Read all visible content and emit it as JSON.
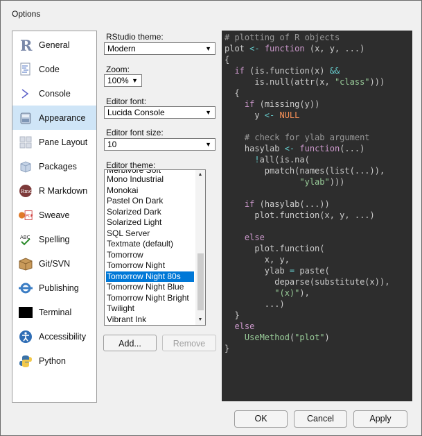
{
  "window": {
    "title": "Options"
  },
  "sidebar": {
    "items": [
      {
        "label": "General",
        "icon": "r-logo-icon"
      },
      {
        "label": "Code",
        "icon": "code-document-icon"
      },
      {
        "label": "Console",
        "icon": "console-prompt-icon"
      },
      {
        "label": "Appearance",
        "icon": "appearance-paint-icon",
        "selected": true
      },
      {
        "label": "Pane Layout",
        "icon": "pane-layout-icon"
      },
      {
        "label": "Packages",
        "icon": "packages-box-icon"
      },
      {
        "label": "R Markdown",
        "icon": "rmarkdown-icon"
      },
      {
        "label": "Sweave",
        "icon": "sweave-pdf-icon"
      },
      {
        "label": "Spelling",
        "icon": "spelling-abc-icon"
      },
      {
        "label": "Git/SVN",
        "icon": "git-svn-box-icon"
      },
      {
        "label": "Publishing",
        "icon": "publishing-icon"
      },
      {
        "label": "Terminal",
        "icon": "terminal-icon"
      },
      {
        "label": "Accessibility",
        "icon": "accessibility-icon"
      },
      {
        "label": "Python",
        "icon": "python-logo-icon"
      }
    ]
  },
  "appearance": {
    "rstudio_theme_label": "RStudio theme:",
    "rstudio_theme_value": "Modern",
    "zoom_label": "Zoom:",
    "zoom_value": "100%",
    "editor_font_label": "Editor font:",
    "editor_font_value": "Lucida Console",
    "editor_font_size_label": "Editor font size:",
    "editor_font_size_value": "10",
    "editor_theme_label": "Editor theme:",
    "themes": [
      "Mono Industrial",
      "Monokai",
      "Pastel On Dark",
      "Solarized Dark",
      "Solarized Light",
      "SQL Server",
      "Textmate (default)",
      "Tomorrow",
      "Tomorrow Night",
      "Tomorrow Night 80s",
      "Tomorrow Night Blue",
      "Tomorrow Night Bright",
      "Twilight",
      "Vibrant Ink"
    ],
    "partial_theme_above": "Merbivore Soft",
    "selected_theme": "Tomorrow Night 80s",
    "add_label": "Add...",
    "remove_label": "Remove"
  },
  "preview": {
    "lines": [
      [
        [
          "c",
          "# plotting of R objects"
        ]
      ],
      [
        [
          "i",
          "plot "
        ],
        [
          "o",
          "<- "
        ],
        [
          "k",
          "function "
        ],
        [
          "p",
          "(x, y, ...)"
        ]
      ],
      [
        [
          "p",
          "{"
        ]
      ],
      [
        [
          "p",
          "  "
        ],
        [
          "k",
          "if "
        ],
        [
          "p",
          "(is.function(x) "
        ],
        [
          "o",
          "&&"
        ]
      ],
      [
        [
          "p",
          "      is.null(attr(x, "
        ],
        [
          "s",
          "\"class\""
        ],
        [
          "p",
          ")))"
        ]
      ],
      [
        [
          "p",
          "  {"
        ]
      ],
      [
        [
          "p",
          "    "
        ],
        [
          "k",
          "if "
        ],
        [
          "p",
          "(missing(y))"
        ]
      ],
      [
        [
          "p",
          "      y "
        ],
        [
          "o",
          "<- "
        ],
        [
          "n",
          "NULL"
        ]
      ],
      [
        [
          "p",
          ""
        ]
      ],
      [
        [
          "c",
          "    # check for ylab argument"
        ]
      ],
      [
        [
          "p",
          "    hasylab "
        ],
        [
          "o",
          "<- "
        ],
        [
          "k",
          "function"
        ],
        [
          "p",
          "(...)"
        ]
      ],
      [
        [
          "p",
          "      "
        ],
        [
          "o",
          "!"
        ],
        [
          "p",
          "all(is.na("
        ]
      ],
      [
        [
          "p",
          "        pmatch(names(list(...)),"
        ]
      ],
      [
        [
          "p",
          "               "
        ],
        [
          "s",
          "\"ylab\""
        ],
        [
          "p",
          ")))"
        ]
      ],
      [
        [
          "p",
          ""
        ]
      ],
      [
        [
          "p",
          "    "
        ],
        [
          "k",
          "if "
        ],
        [
          "p",
          "(hasylab(...))"
        ]
      ],
      [
        [
          "p",
          "      plot.function(x, y, ...)"
        ]
      ],
      [
        [
          "p",
          ""
        ]
      ],
      [
        [
          "p",
          "    "
        ],
        [
          "k",
          "else"
        ]
      ],
      [
        [
          "p",
          "      plot.function("
        ]
      ],
      [
        [
          "p",
          "        x, y,"
        ]
      ],
      [
        [
          "p",
          "        ylab "
        ],
        [
          "o",
          "= "
        ],
        [
          "p",
          "paste("
        ]
      ],
      [
        [
          "p",
          "          deparse(substitute(x)),"
        ]
      ],
      [
        [
          "p",
          "          "
        ],
        [
          "s",
          "\"(x)\""
        ],
        [
          "p",
          "),"
        ]
      ],
      [
        [
          "p",
          "        ...)"
        ]
      ],
      [
        [
          "p",
          "  }"
        ]
      ],
      [
        [
          "p",
          "  "
        ],
        [
          "k",
          "else"
        ]
      ],
      [
        [
          "p",
          "    "
        ],
        [
          "s",
          "UseMethod"
        ],
        [
          "p",
          "("
        ],
        [
          "s",
          "\"plot\""
        ],
        [
          "p",
          ")"
        ]
      ],
      [
        [
          "p",
          "}"
        ]
      ]
    ]
  },
  "footer": {
    "ok_label": "OK",
    "cancel_label": "Cancel",
    "apply_label": "Apply"
  },
  "colors": {
    "editor_bg": "#2d2d2d",
    "comment": "#999999",
    "keyword": "#cc99cc",
    "operator": "#66cccc",
    "string": "#99cc99",
    "constant": "#f99157",
    "text": "#cccccc",
    "identifier": "#cccccc",
    "selection": "#0078d7",
    "sidebar_selected": "#cfe5f7"
  }
}
